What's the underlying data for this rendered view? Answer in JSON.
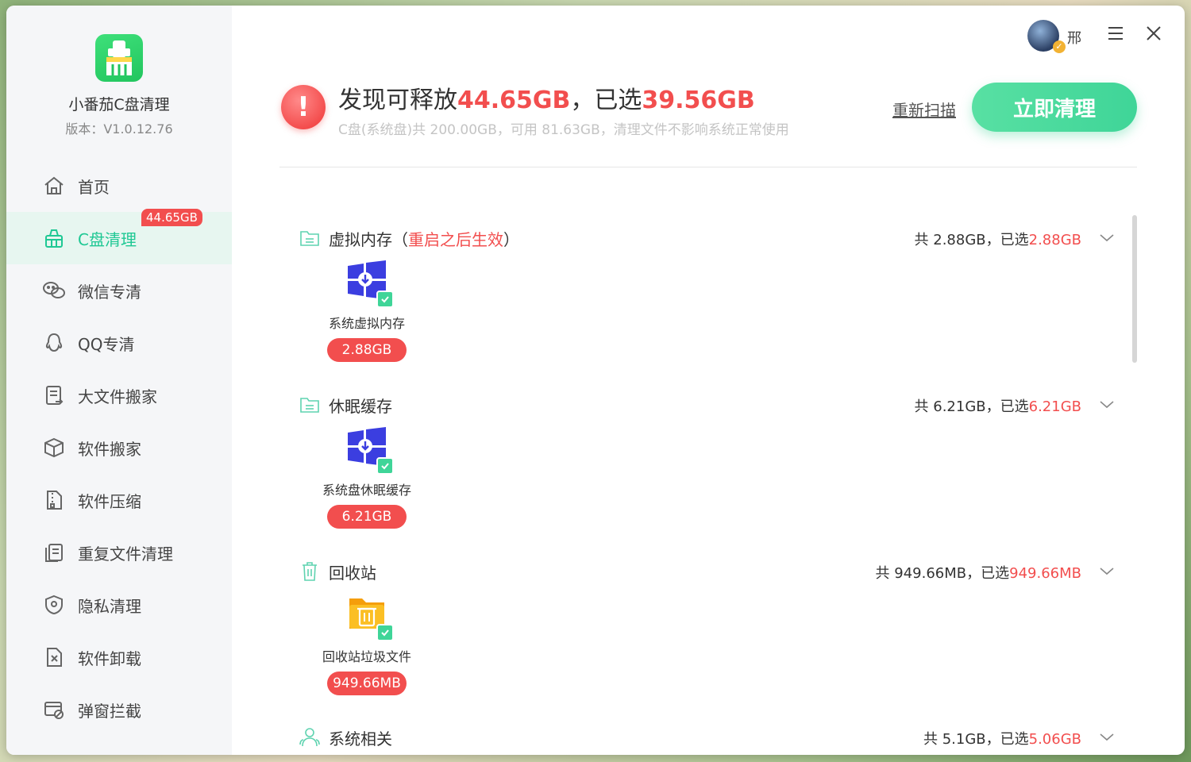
{
  "app": {
    "name": "小番茄C盘清理",
    "version": "版本：V1.0.12.76"
  },
  "nav": [
    {
      "label": "首页",
      "icon": "home-icon"
    },
    {
      "label": "C盘清理",
      "icon": "basket-icon",
      "badge": "44.65GB",
      "active": true
    },
    {
      "label": "微信专清",
      "icon": "wechat-icon"
    },
    {
      "label": "QQ专清",
      "icon": "qq-icon"
    },
    {
      "label": "大文件搬家",
      "icon": "file-move-icon"
    },
    {
      "label": "软件搬家",
      "icon": "package-icon"
    },
    {
      "label": "软件压缩",
      "icon": "zip-icon"
    },
    {
      "label": "重复文件清理",
      "icon": "duplicate-icon"
    },
    {
      "label": "隐私清理",
      "icon": "shield-icon"
    },
    {
      "label": "软件卸载",
      "icon": "uninstall-icon"
    },
    {
      "label": "弹窗拦截",
      "icon": "popup-block-icon"
    }
  ],
  "user": {
    "name": "邢"
  },
  "summary": {
    "prefix": "发现可释放",
    "found": "44.65GB",
    "mid": "，已选",
    "selected": "39.56GB",
    "disk_info": "C盘(系统盘)共 200.00GB，可用 81.63GB，清理文件不影响系统正常使用"
  },
  "actions": {
    "rescan": "重新扫描",
    "clean_now": "立即清理"
  },
  "sections": [
    {
      "title": "虚拟内存",
      "note_open": "（",
      "note": "重启之后生效",
      "note_close": "）",
      "stats_total": "共 2.88GB，已选",
      "stats_selected": "2.88GB",
      "item": {
        "label": "系统虚拟内存",
        "size": "2.88GB",
        "icon": "windows-icon"
      }
    },
    {
      "title": "休眠缓存",
      "stats_total": "共 6.21GB，已选",
      "stats_selected": "6.21GB",
      "item": {
        "label": "系统盘休眠缓存",
        "size": "6.21GB",
        "icon": "windows-icon"
      }
    },
    {
      "title": "回收站",
      "stats_total": "共 949.66MB，已选",
      "stats_selected": "949.66MB",
      "item": {
        "label": "回收站垃圾文件",
        "size": "949.66MB",
        "icon": "recycle-folder-icon"
      }
    },
    {
      "title": "系统相关",
      "stats_total": "共 5.1GB，已选",
      "stats_selected": "5.06GB"
    }
  ],
  "colors": {
    "accent": "#1fc894",
    "danger": "#f24e4e",
    "button": "#3fd598"
  }
}
